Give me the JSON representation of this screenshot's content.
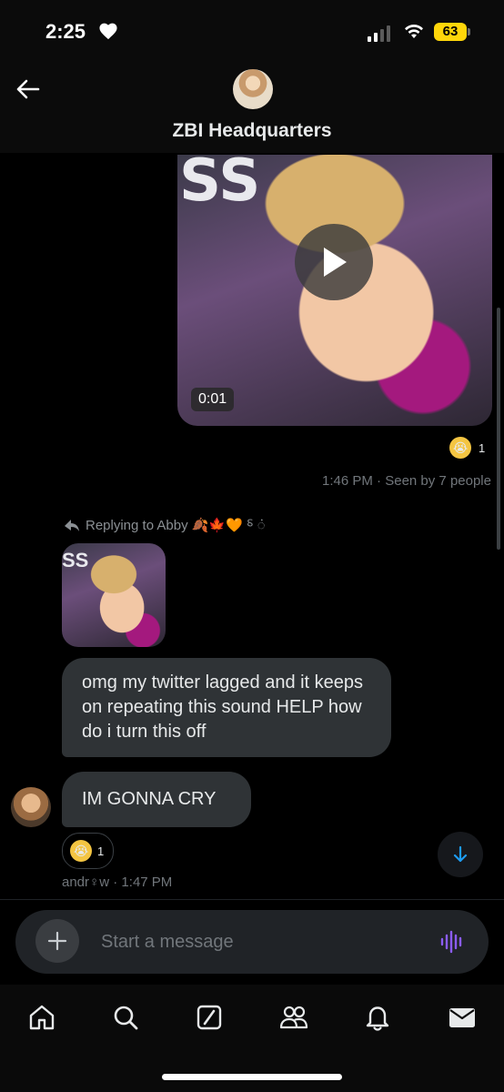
{
  "status_bar": {
    "time": "2:25",
    "battery": "63"
  },
  "header": {
    "title": "ZBI Headquarters"
  },
  "messages": {
    "video": {
      "duration": "0:01",
      "reaction_count": "1",
      "meta": "1:46 PM · Seen by 7 people"
    },
    "reply_label": "Replying to Abby 🍂🍁🧡 ⸹ ं",
    "bubble_1": "omg my twitter lagged and it keeps on repeating this sound HELP how do i turn this off",
    "bubble_2": "IM GONNA CRY",
    "reaction_count": "1",
    "sender_meta": "andr♀w · 1:47 PM"
  },
  "composer": {
    "placeholder": "Start a message"
  },
  "thumb_text": "SS",
  "colors": {
    "bubble": "#2f3336",
    "accent": "#1d9bf0",
    "voice": "#8b5cf6",
    "battery": "#ffd60a"
  },
  "nav": [
    "home-icon",
    "search-icon",
    "grok-icon",
    "communities-icon",
    "notifications-icon",
    "messages-icon"
  ]
}
